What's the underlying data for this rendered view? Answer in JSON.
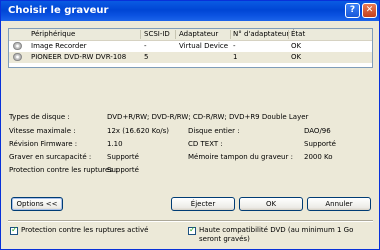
{
  "window": {
    "title": "Choisir le graveur",
    "help_icon": "?",
    "close_icon": "✕"
  },
  "list": {
    "columns": [
      "Périphérique",
      "SCSI-ID",
      "Adaptateur",
      "N° d'adaptateur",
      "État"
    ],
    "rows": [
      [
        "Image Recorder",
        "-",
        "Virtual Device",
        "-",
        "OK"
      ],
      [
        "PIONEER  DVD-RW  DVR-108",
        "5",
        "",
        "1",
        "OK"
      ]
    ]
  },
  "properties": {
    "disc_types_label": "Types de disque :",
    "disc_types_value": "DVD+R/RW; DVD-R/RW; CD-R/RW; DVD+R9 Double Layer",
    "max_speed_label": "Vitesse maximale :",
    "max_speed_value": "12x (16.620 Ko/s)",
    "firmware_label": "Révision Firmware :",
    "firmware_value": "1.10",
    "overburn_label": "Graver en surcapacité :",
    "overburn_value": "Supporté",
    "underrun_label": "Protection contre les ruptures :",
    "underrun_value": "Supporté",
    "disc_at_once_label": "Disque entier :",
    "disc_at_once_value": "DAO/96",
    "cd_text_label": "CD TEXT :",
    "cd_text_value": "Supporté",
    "buffer_label": "Mémoire tampon du graveur :",
    "buffer_value": "2000 Ko"
  },
  "buttons": {
    "options": "Options <<",
    "eject": "Éjecter",
    "ok": "OK",
    "cancel": "Annuler"
  },
  "checkboxes": {
    "underrun_label": "Protection contre les ruptures activé",
    "underrun_checked": true,
    "dvd_compat_label": "Haute compatibilité DVD (au minimum 1 Go seront gravés)",
    "dvd_compat_checked": true
  }
}
